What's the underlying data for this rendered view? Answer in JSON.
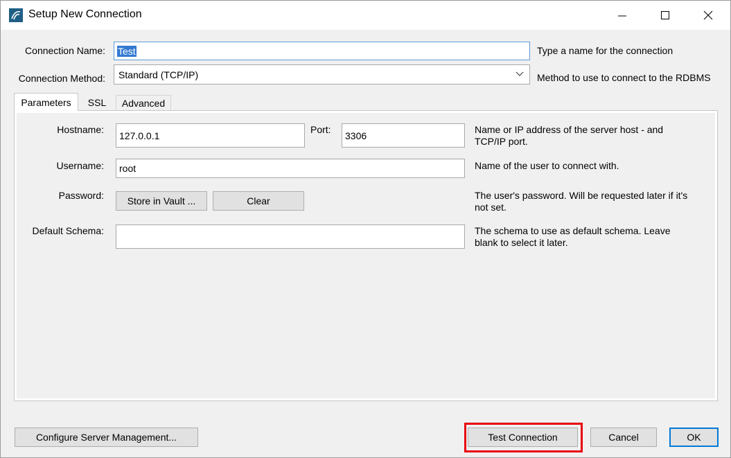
{
  "window": {
    "title": "Setup New Connection"
  },
  "connection_name": {
    "label": "Connection Name:",
    "value": "Test",
    "hint": "Type a name for the connection"
  },
  "connection_method": {
    "label": "Connection Method:",
    "value": "Standard (TCP/IP)",
    "hint": "Method to use to connect to the RDBMS"
  },
  "tabs": [
    {
      "label": "Parameters",
      "active": true
    },
    {
      "label": "SSL",
      "active": false
    },
    {
      "label": "Advanced",
      "active": false
    }
  ],
  "parameters": {
    "hostname_label": "Hostname:",
    "hostname_value": "127.0.0.1",
    "port_label": "Port:",
    "port_value": "3306",
    "host_hint_1": "Name or IP address of the server host - and",
    "host_hint_2": "TCP/IP port.",
    "username_label": "Username:",
    "username_value": "root",
    "username_hint": "Name of the user to connect with.",
    "password_label": "Password:",
    "store_vault_label": "Store in Vault ...",
    "clear_label": "Clear",
    "password_hint_1": "The user's password. Will be requested later if it's",
    "password_hint_2": "not set.",
    "schema_label": "Default Schema:",
    "schema_value": "",
    "schema_hint_1": "The schema to use as default schema. Leave",
    "schema_hint_2": "blank to select it later."
  },
  "footer": {
    "configure_label": "Configure Server Management...",
    "test_label": "Test Connection",
    "cancel_label": "Cancel",
    "ok_label": "OK"
  },
  "colors": {
    "highlight": "#e8000b",
    "accent": "#0078d7"
  }
}
